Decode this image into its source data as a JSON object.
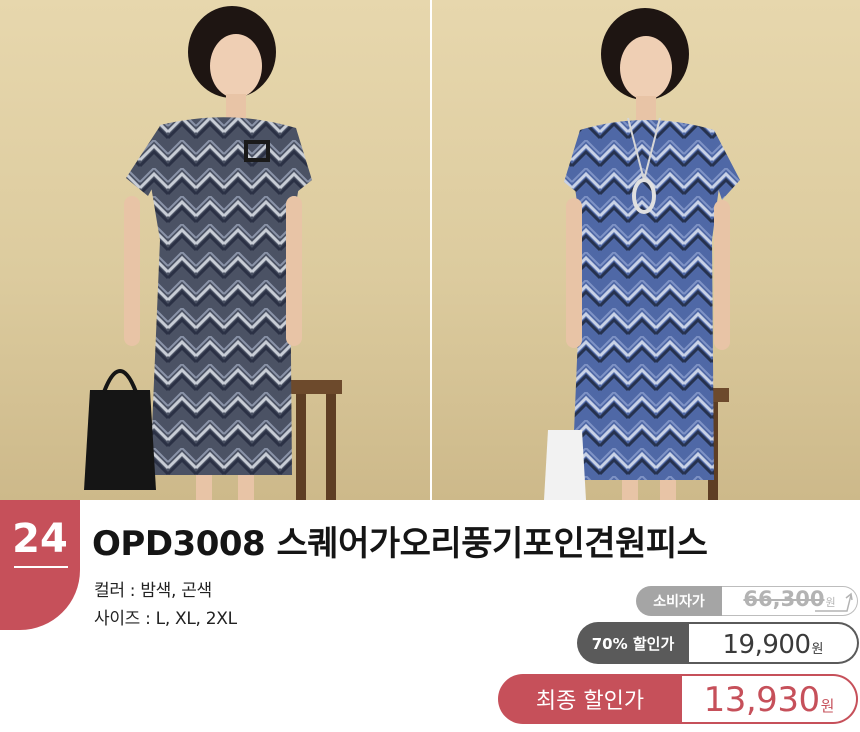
{
  "product": {
    "number": "24",
    "title": "OPD3008  스퀘어가오리풍기포인견원피스",
    "color_line": "컬러 : 밤색, 곤색",
    "size_line": "사이즈 : L, XL, 2XL"
  },
  "prices": {
    "consumer_label": "소비자가",
    "consumer_price": "66,300",
    "discount_label": "70% 할인가",
    "discount_price": "19,900",
    "final_label": "최종 할인가",
    "final_price": "13,930",
    "currency": "원"
  },
  "photos": [
    {
      "name": "model-photo-brown-dress",
      "dress_color": "#5b6070"
    },
    {
      "name": "model-photo-navy-dress",
      "dress_color": "#5a6d9e"
    }
  ],
  "colors": {
    "accent": "#c6505a",
    "discount_dark": "#5a5a5a",
    "consumer_gray": "#a5a5a5"
  }
}
